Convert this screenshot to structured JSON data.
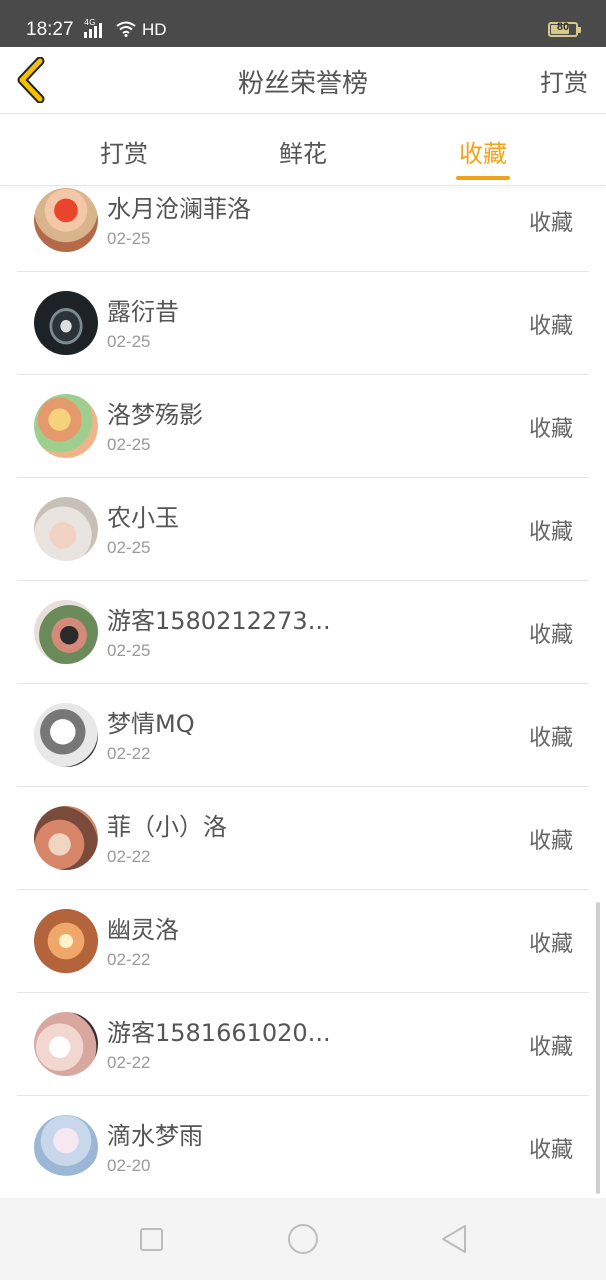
{
  "status_bar": {
    "time": "18:27",
    "network": "4G",
    "hd": "HD",
    "battery": "80",
    "battery_level": 0.8
  },
  "nav": {
    "back_icon": "chevron-left-icon",
    "title": "粉丝荣誉榜",
    "action_label": "打赏"
  },
  "tabs": [
    {
      "label": "打赏",
      "active": false
    },
    {
      "label": "鲜花",
      "active": false
    },
    {
      "label": "收藏",
      "active": true
    }
  ],
  "colors": {
    "accent": "#f2a31b",
    "back_arrow": "#f2c200",
    "text": "#555555",
    "date": "#9a9a9a"
  },
  "list": [
    {
      "name": "水月沧澜菲洛",
      "date": "02-25",
      "action": "收藏"
    },
    {
      "name": "露衍昔",
      "date": "02-25",
      "action": "收藏"
    },
    {
      "name": "洛梦殇影",
      "date": "02-25",
      "action": "收藏"
    },
    {
      "name": "农小玉",
      "date": "02-25",
      "action": "收藏"
    },
    {
      "name": "游客1580212273...",
      "date": "02-25",
      "action": "收藏"
    },
    {
      "name": "梦情MQ",
      "date": "02-22",
      "action": "收藏"
    },
    {
      "name": "菲（小）洛",
      "date": "02-22",
      "action": "收藏"
    },
    {
      "name": "幽灵洛",
      "date": "02-22",
      "action": "收藏"
    },
    {
      "name": "游客1581661020...",
      "date": "02-22",
      "action": "收藏"
    },
    {
      "name": "滴水梦雨",
      "date": "02-20",
      "action": "收藏"
    }
  ],
  "system_nav": {
    "icons": [
      "recent-apps-icon",
      "home-icon",
      "back-triangle-icon"
    ]
  }
}
